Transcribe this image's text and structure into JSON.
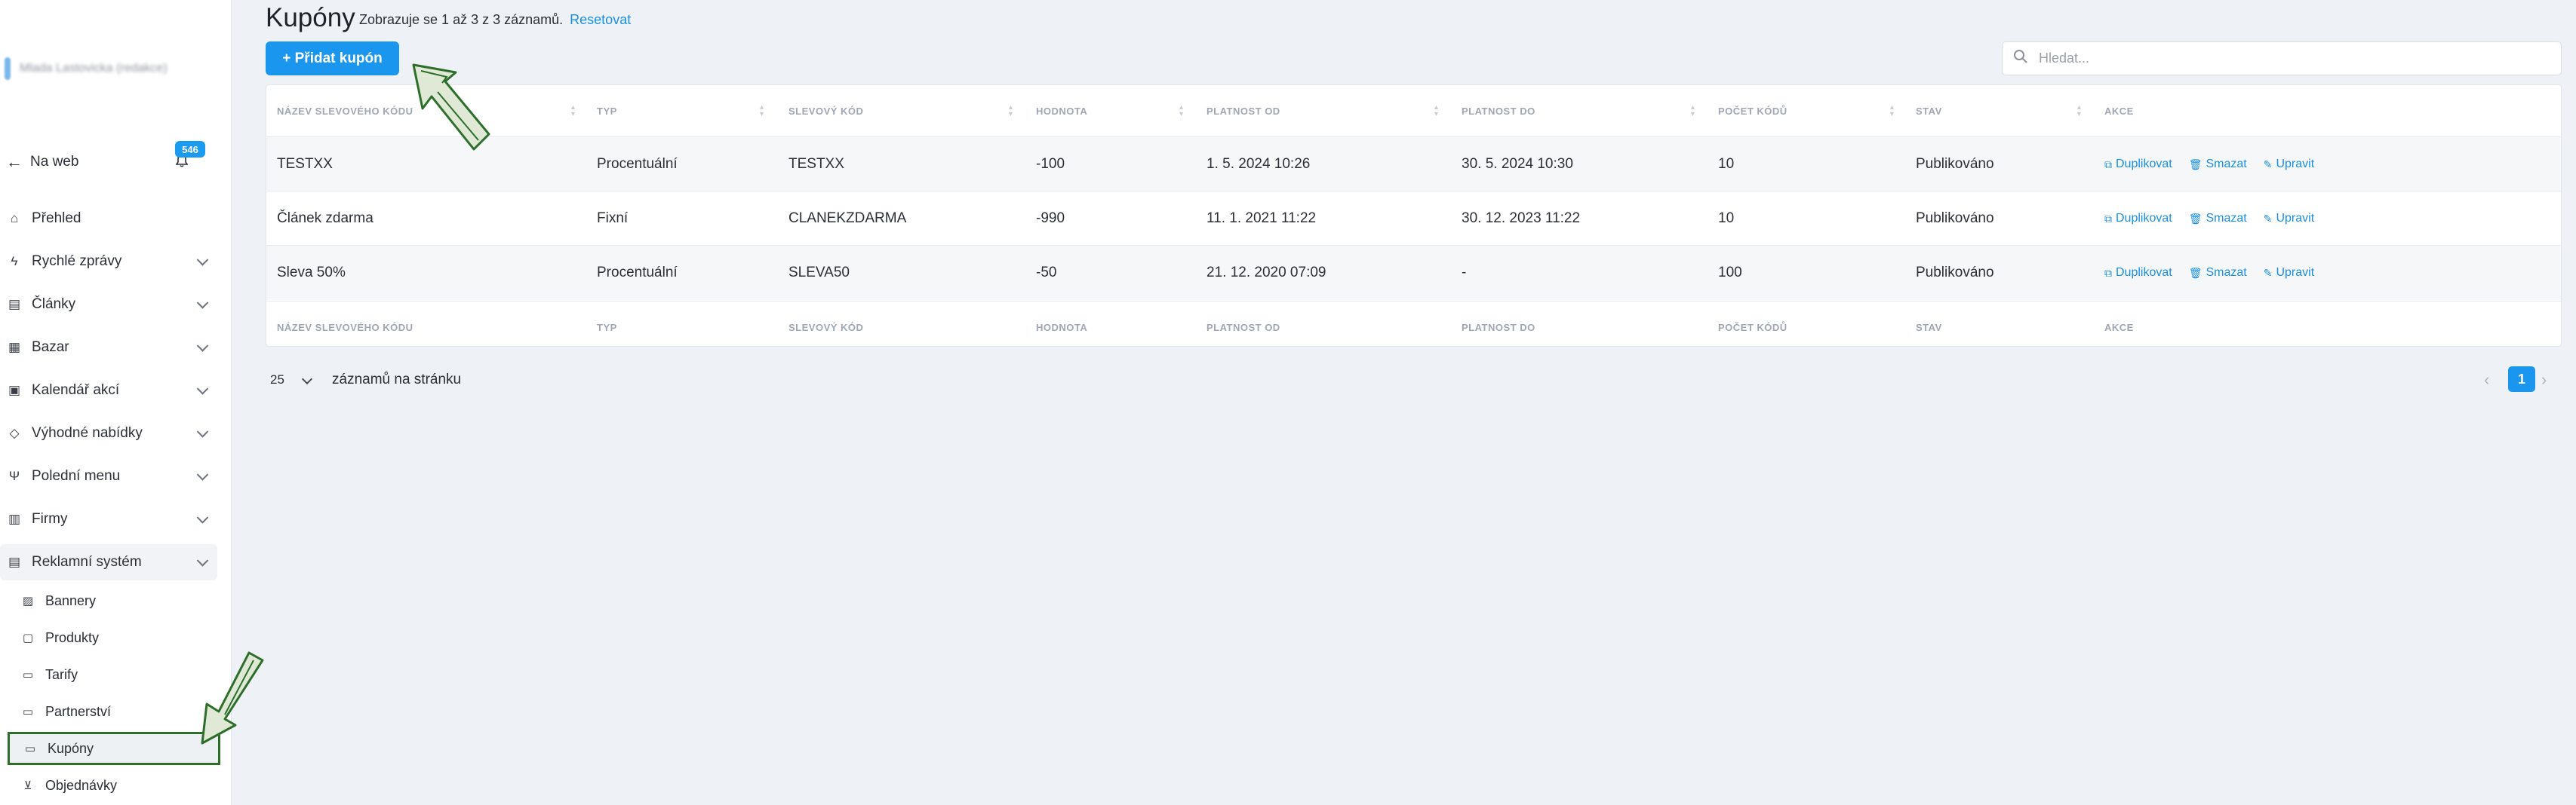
{
  "sidebar": {
    "brand": "Mlada Lastovicka (redakce)",
    "web_link": "Na web",
    "notif_count": "546",
    "items": [
      {
        "label": "Přehled",
        "icon": "house-icon",
        "glyph": "⌂"
      },
      {
        "label": "Rychlé zprávy",
        "icon": "bolt-icon",
        "glyph": "ϟ"
      },
      {
        "label": "Články",
        "icon": "newspaper-icon",
        "glyph": "▤"
      },
      {
        "label": "Bazar",
        "icon": "shop-icon",
        "glyph": "▦"
      },
      {
        "label": "Kalendář akcí",
        "icon": "calendar-icon",
        "glyph": "▣"
      },
      {
        "label": "Výhodné nabídky",
        "icon": "tag-icon",
        "glyph": "◇"
      },
      {
        "label": "Polední menu",
        "icon": "cutlery-icon",
        "glyph": "Ψ"
      },
      {
        "label": "Firmy",
        "icon": "building-icon",
        "glyph": "▥"
      },
      {
        "label": "Reklamní systém",
        "icon": "ads-icon",
        "glyph": "▤"
      }
    ],
    "sub_items": [
      {
        "label": "Bannery",
        "icon": "image-icon",
        "glyph": "▨"
      },
      {
        "label": "Produkty",
        "icon": "package-icon",
        "glyph": "▢"
      },
      {
        "label": "Tarify",
        "icon": "ticket-icon",
        "glyph": "▭"
      },
      {
        "label": "Partnerství",
        "icon": "handshake-icon",
        "glyph": "▭"
      },
      {
        "label": "Kupóny",
        "icon": "coupon-icon",
        "glyph": "▭"
      },
      {
        "label": "Objednávky",
        "icon": "cart-icon",
        "glyph": "⊻"
      }
    ]
  },
  "header": {
    "title": "Kupóny",
    "subtitle": "Zobrazuje se 1 až 3 z 3 záznamů.",
    "reset": "Resetovat",
    "add_button": "+ Přidat kupón",
    "search_placeholder": "Hledat..."
  },
  "table": {
    "columns": [
      "NÁZEV SLEVOVÉHO KÓDU",
      "TYP",
      "SLEVOVÝ KÓD",
      "HODNOTA",
      "PLATNOST OD",
      "PLATNOST DO",
      "POČET KÓDŮ",
      "STAV",
      "AKCE"
    ],
    "rows": [
      [
        "TESTXX",
        "Procentuální",
        "TESTXX",
        "-100",
        "1. 5. 2024 10:26",
        "30. 5. 2024 10:30",
        "10",
        "Publikováno"
      ],
      [
        "Článek zdarma",
        "Fixní",
        "CLANEKZDARMA",
        "-990",
        "11. 1. 2021 11:22",
        "30. 12. 2023 11:22",
        "10",
        "Publikováno"
      ],
      [
        "Sleva 50%",
        "Procentuální",
        "SLEVA50",
        "-50",
        "21. 12. 2020 07:09",
        "-",
        "100",
        "Publikováno"
      ]
    ],
    "actions": [
      "Duplikovat",
      "Smazat",
      "Upravit"
    ]
  },
  "footer": {
    "per_page": "25",
    "per_page_label": "záznamů na stránku",
    "page": "1",
    "prev": "‹",
    "next": "›"
  },
  "colors": {
    "accent": "#1a96ef",
    "arrow": "#2c6e2a"
  }
}
